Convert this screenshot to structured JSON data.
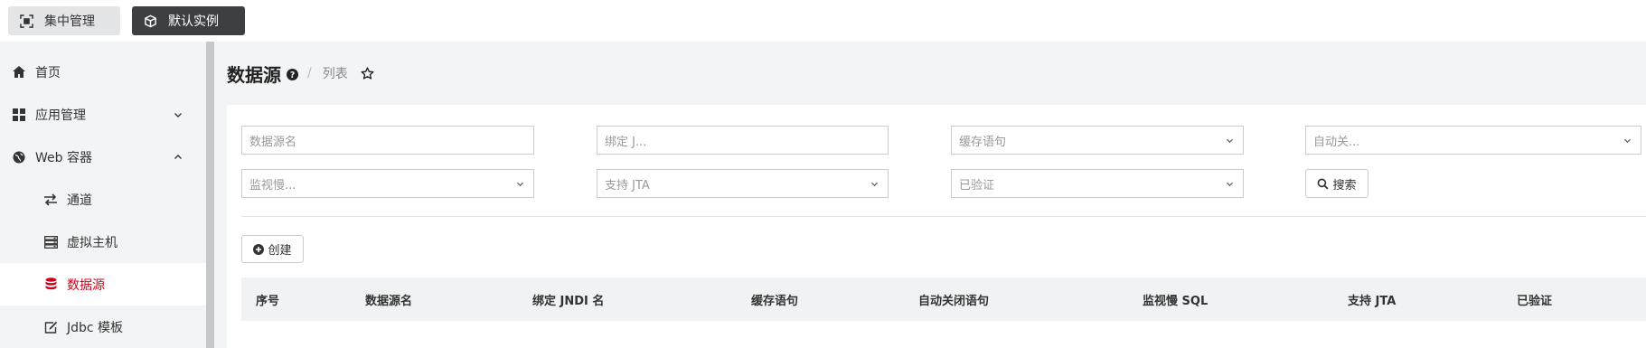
{
  "topbar": {
    "central_label": "集中管理",
    "instance_label": "默认实例"
  },
  "sidebar": {
    "items": [
      {
        "label": "首页",
        "icon": "home-icon"
      },
      {
        "label": "应用管理",
        "icon": "grid-icon",
        "expanded": false
      },
      {
        "label": "Web 容器",
        "icon": "globe-icon",
        "expanded": true
      },
      {
        "label": "通道",
        "icon": "exchange-icon"
      },
      {
        "label": "虚拟主机",
        "icon": "server-icon"
      },
      {
        "label": "数据源",
        "icon": "database-icon",
        "active": true
      },
      {
        "label": "Jdbc 模板",
        "icon": "edit-icon"
      }
    ],
    "active_color": "#d0021b"
  },
  "header": {
    "title": "数据源",
    "breadcrumb": "列表",
    "separator": "/"
  },
  "filters": {
    "datasource_name_placeholder": "数据源名",
    "jndi_placeholder": "绑定 J...",
    "cache_statement_placeholder": "缓存语句",
    "auto_close_placeholder": "自动关...",
    "monitor_slow_placeholder": "监视慢...",
    "support_jta_placeholder": "支持 JTA",
    "verified_placeholder": "已验证",
    "search_label": "搜索"
  },
  "actions": {
    "create_label": "创建"
  },
  "table": {
    "columns": [
      "序号",
      "数据源名",
      "绑定 JNDI 名",
      "缓存语句",
      "自动关闭语句",
      "监视慢 SQL",
      "支持 JTA",
      "已验证"
    ]
  }
}
